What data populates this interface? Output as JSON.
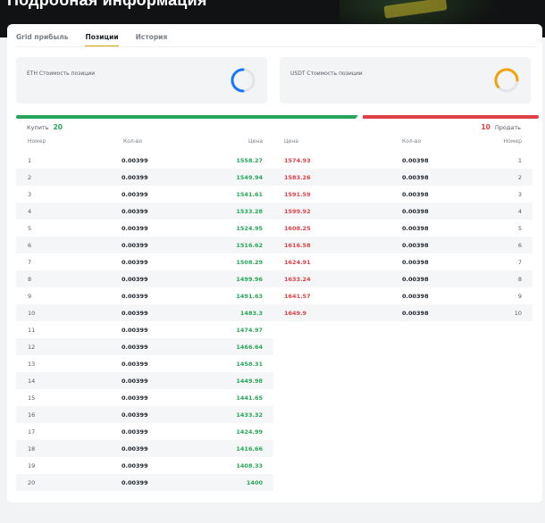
{
  "header": {
    "title": "Подробная информация"
  },
  "tabs": [
    {
      "label": "Grid прибыль"
    },
    {
      "label": "Позиции"
    },
    {
      "label": "История"
    }
  ],
  "summary": {
    "eth_label": "ETH Стоимость позиции",
    "usdt_label": "USDT Стоимость позиции"
  },
  "ratio": {
    "buy_label": "Купить",
    "buy_count": "20",
    "sell_count": "10",
    "sell_label": "Продать"
  },
  "columns": {
    "buy": {
      "num": "Номер",
      "qty": "Кол-во",
      "price": "Цена"
    },
    "sell": {
      "price": "Цена",
      "qty": "Кол-во",
      "num": "Номер"
    }
  },
  "buy_orders": [
    {
      "num": "1",
      "qty": "0.00399",
      "price": "1558.27"
    },
    {
      "num": "2",
      "qty": "0.00399",
      "price": "1549.94"
    },
    {
      "num": "3",
      "qty": "0.00399",
      "price": "1541.61"
    },
    {
      "num": "4",
      "qty": "0.00399",
      "price": "1533.28"
    },
    {
      "num": "5",
      "qty": "0.00399",
      "price": "1524.95"
    },
    {
      "num": "6",
      "qty": "0.00399",
      "price": "1516.62"
    },
    {
      "num": "7",
      "qty": "0.00399",
      "price": "1508.29"
    },
    {
      "num": "8",
      "qty": "0.00399",
      "price": "1499.96"
    },
    {
      "num": "9",
      "qty": "0.00399",
      "price": "1491.63"
    },
    {
      "num": "10",
      "qty": "0.00399",
      "price": "1483.3"
    },
    {
      "num": "11",
      "qty": "0.00399",
      "price": "1474.97"
    },
    {
      "num": "12",
      "qty": "0.00399",
      "price": "1466.64"
    },
    {
      "num": "13",
      "qty": "0.00399",
      "price": "1458.31"
    },
    {
      "num": "14",
      "qty": "0.00399",
      "price": "1449.98"
    },
    {
      "num": "15",
      "qty": "0.00399",
      "price": "1441.65"
    },
    {
      "num": "16",
      "qty": "0.00399",
      "price": "1433.32"
    },
    {
      "num": "17",
      "qty": "0.00399",
      "price": "1424.99"
    },
    {
      "num": "18",
      "qty": "0.00399",
      "price": "1416.66"
    },
    {
      "num": "19",
      "qty": "0.00399",
      "price": "1408.33"
    },
    {
      "num": "20",
      "qty": "0.00399",
      "price": "1400"
    }
  ],
  "sell_orders": [
    {
      "price": "1574.93",
      "qty": "0.00398",
      "num": "1"
    },
    {
      "price": "1583.26",
      "qty": "0.00398",
      "num": "2"
    },
    {
      "price": "1591.59",
      "qty": "0.00398",
      "num": "3"
    },
    {
      "price": "1599.92",
      "qty": "0.00398",
      "num": "4"
    },
    {
      "price": "1608.25",
      "qty": "0.00398",
      "num": "5"
    },
    {
      "price": "1616.58",
      "qty": "0.00398",
      "num": "6"
    },
    {
      "price": "1624.91",
      "qty": "0.00398",
      "num": "7"
    },
    {
      "price": "1633.24",
      "qty": "0.00398",
      "num": "8"
    },
    {
      "price": "1641.57",
      "qty": "0.00398",
      "num": "9"
    },
    {
      "price": "1649.9",
      "qty": "0.00398",
      "num": "10"
    }
  ],
  "colors": {
    "buy": "#27a65a",
    "sell": "#e04148",
    "eth_ring": "#1677ff",
    "usdt_ring": "#f0a30a",
    "tab_underline": "#d6a700"
  },
  "icons": {
    "eth_chart": "donut-chart-icon",
    "usdt_chart": "donut-chart-icon"
  }
}
